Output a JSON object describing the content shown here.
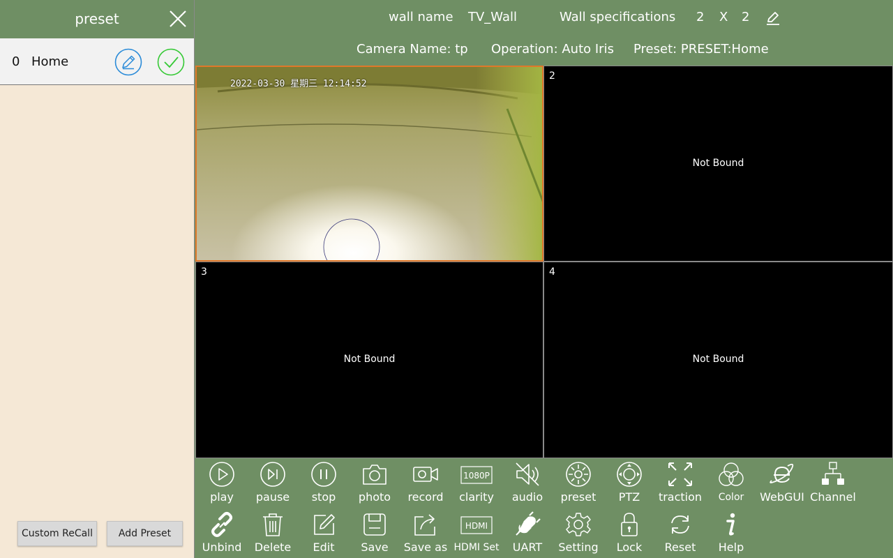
{
  "preset_panel": {
    "title": "preset",
    "items": [
      {
        "index": "0",
        "name": "Home"
      }
    ],
    "custom_recall_label": "Custom ReCall",
    "add_preset_label": "Add Preset"
  },
  "header": {
    "wall_name_label": "wall name",
    "wall_name_value": "TV_Wall",
    "wall_spec_label": "Wall specifications",
    "wall_rows": "2",
    "wall_x": "X",
    "wall_cols": "2",
    "camera_name": "Camera Name: tp",
    "operation": "Operation: Auto Iris",
    "preset": "Preset: PRESET:Home"
  },
  "video": {
    "timestamp": "2022-03-30 星期三 12:14:52",
    "cells": [
      {
        "number": "",
        "status": ""
      },
      {
        "number": "2",
        "status": "Not Bound"
      },
      {
        "number": "3",
        "status": "Not Bound"
      },
      {
        "number": "4",
        "status": "Not Bound"
      }
    ]
  },
  "toolbar": {
    "row1": [
      {
        "label": "play",
        "icon": "play-icon"
      },
      {
        "label": "pause",
        "icon": "pause-icon"
      },
      {
        "label": "stop",
        "icon": "stop-icon"
      },
      {
        "label": "photo",
        "icon": "camera-icon"
      },
      {
        "label": "record",
        "icon": "video-record-icon"
      },
      {
        "label": "clarity",
        "icon": "resolution-1080p-icon",
        "badge": "1080P"
      },
      {
        "label": "audio",
        "icon": "audio-mute-icon"
      },
      {
        "label": "preset",
        "icon": "preset-icon"
      },
      {
        "label": "PTZ",
        "icon": "ptz-icon"
      },
      {
        "label": "traction",
        "icon": "fullscreen-icon"
      },
      {
        "label": "Color",
        "icon": "color-icon"
      },
      {
        "label": "WebGUI",
        "icon": "browser-icon"
      },
      {
        "label": "Channel",
        "icon": "channel-tree-icon"
      }
    ],
    "row2": [
      {
        "label": "Unbind",
        "icon": "link-icon"
      },
      {
        "label": "Delete",
        "icon": "trash-icon"
      },
      {
        "label": "Edit",
        "icon": "edit-icon"
      },
      {
        "label": "Save",
        "icon": "save-icon"
      },
      {
        "label": "Save as",
        "icon": "share-icon"
      },
      {
        "label": "HDMI Set",
        "icon": "hdmi-icon",
        "badge": "HDMI"
      },
      {
        "label": "UART",
        "icon": "plug-icon"
      },
      {
        "label": "Setting",
        "icon": "gear-icon"
      },
      {
        "label": "Lock",
        "icon": "lock-icon"
      },
      {
        "label": "Reset",
        "icon": "refresh-icon"
      },
      {
        "label": "Help",
        "icon": "info-icon"
      }
    ]
  },
  "colors": {
    "header_bg": "#6f8f64",
    "panel_bg": "#f5e8d6",
    "active_border": "#e0782a",
    "edit_blue": "#2a8bd8",
    "confirm_green": "#35c935"
  }
}
